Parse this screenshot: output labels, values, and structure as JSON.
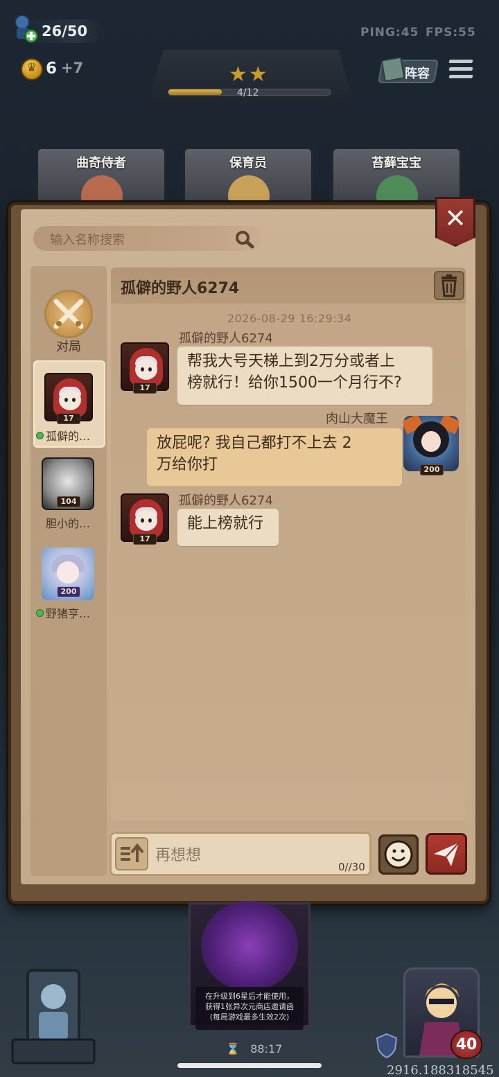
{
  "hud": {
    "population": "26/50",
    "ping": "PING:45",
    "fps": "FPS:55",
    "gold": "6",
    "gold_income": "+7",
    "round_progress_text": "4/12",
    "round_progress_fraction": 0.33,
    "stars": "★★",
    "lineup_label": "阵容"
  },
  "shop": {
    "cards": [
      {
        "name": "曲奇侍者"
      },
      {
        "name": "保育员"
      },
      {
        "name": "苔藓宝宝"
      }
    ]
  },
  "chat": {
    "search_placeholder": "输入名称搜索",
    "close_label": "✕",
    "sidebar": {
      "battle_label": "对局",
      "contacts": [
        {
          "name": "孤僻的…",
          "level": "17",
          "online": true
        },
        {
          "name": "胆小的…",
          "level": "104",
          "online": false
        },
        {
          "name": "野猪亨…",
          "level": "200",
          "online": true
        }
      ]
    },
    "header_title": "孤僻的野人6274",
    "timestamp": "2026-08-29 16:29:34",
    "messages": [
      {
        "sender": "孤僻的野人6274",
        "level": "17",
        "text_lines": [
          "帮我大号天梯上到2万分或者上",
          "榜就行！给你1500一个月行不?"
        ],
        "mine": false
      },
      {
        "sender": "肉山大魔王",
        "level": "200",
        "text_lines": [
          "放屁呢? 我自己都打不上去 2",
          "万给你打"
        ],
        "mine": true
      },
      {
        "sender": "孤僻的野人6274",
        "level": "17",
        "text_lines": [
          "能上榜就行"
        ],
        "mine": false
      }
    ],
    "input_placeholder": "再想想",
    "char_count": "0//30"
  },
  "bottom": {
    "card_note_lines": [
      "在升级到6星后才能使用，",
      "获得1张异次元商店邀请函",
      "(每局游戏最多生效2次)"
    ],
    "timer": "88:17",
    "hp": "40",
    "number": "2916.188318545"
  },
  "colors": {
    "paper": "#c7ac8d",
    "frame": "#6b5238",
    "close_red": "#9b3a32",
    "bubble_other": "#ecdcc3",
    "bubble_mine": "#e8c896",
    "online_green": "#4fb84a"
  }
}
